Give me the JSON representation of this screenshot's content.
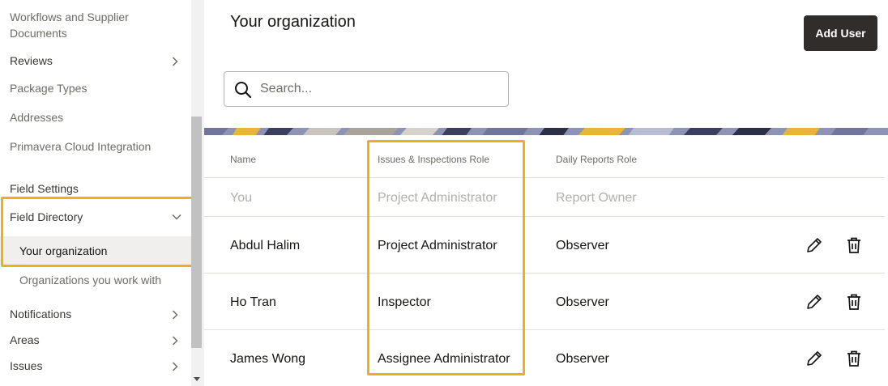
{
  "sidebar": {
    "items": [
      {
        "label": "Workflows and Supplier Documents",
        "chevron": "none"
      },
      {
        "label": "Reviews",
        "chevron": "right"
      },
      {
        "label": "Package Types",
        "chevron": "none"
      },
      {
        "label": "Addresses",
        "chevron": "none"
      },
      {
        "label": "Primavera Cloud Integration",
        "chevron": "none"
      }
    ],
    "section_heading": "Field Settings",
    "field_directory": {
      "label": "Field Directory",
      "chevron": "down",
      "children": [
        {
          "label": "Your organization",
          "selected": true
        },
        {
          "label": "Organizations you work with",
          "selected": false
        }
      ]
    },
    "bottom_items": [
      {
        "label": "Notifications",
        "chevron": "right"
      },
      {
        "label": "Areas",
        "chevron": "right"
      },
      {
        "label": "Issues",
        "chevron": "right"
      }
    ]
  },
  "main": {
    "title": "Your organization",
    "add_user_label": "Add User",
    "search": {
      "placeholder": "Search...",
      "value": ""
    },
    "table": {
      "headers": [
        "Name",
        "Issues & Inspections Role",
        "Daily Reports Role"
      ],
      "rows": [
        {
          "name": "You",
          "issues_role": "Project Administrator",
          "daily_role": "Report Owner",
          "muted": true
        },
        {
          "name": "Abdul Halim",
          "issues_role": "Project Administrator",
          "daily_role": "Observer",
          "muted": false
        },
        {
          "name": "Ho Tran",
          "issues_role": "Inspector",
          "daily_role": "Observer",
          "muted": false
        },
        {
          "name": "James Wong",
          "issues_role": "Assignee Administrator",
          "daily_role": "Observer",
          "muted": false
        }
      ]
    }
  },
  "colors": {
    "highlight": "#f0ad1c",
    "button_bg": "#312d2a",
    "selected_bg": "#f1efed"
  },
  "icons": [
    "search-icon",
    "chevron-right-icon",
    "chevron-down-icon",
    "pencil-icon",
    "trash-icon"
  ]
}
